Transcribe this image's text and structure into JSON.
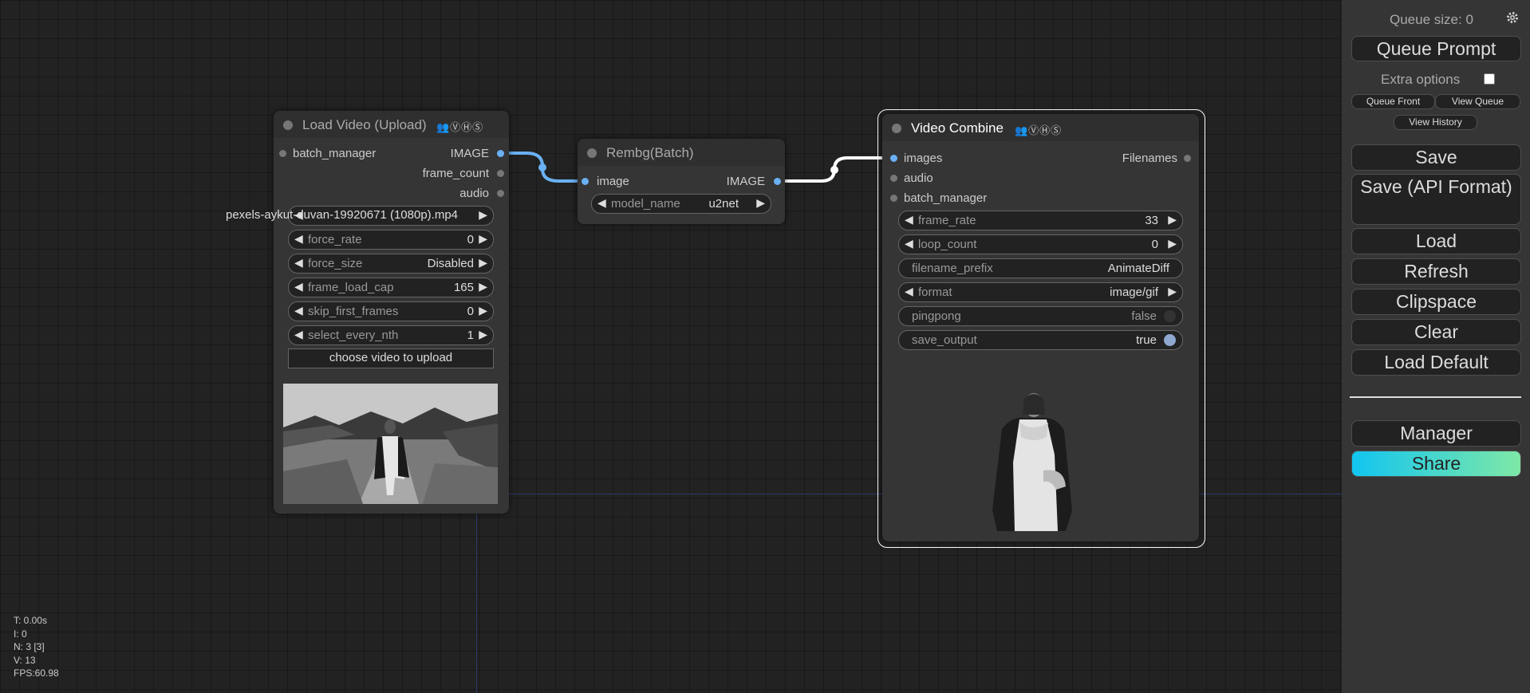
{
  "load_video": {
    "title": "Load Video (Upload)",
    "badges": "👥ⓋⒽⓈ",
    "inputs": [
      "batch_manager"
    ],
    "outputs": [
      "IMAGE",
      "frame_count",
      "audio"
    ],
    "video_name": "pexels-aykut-duvan-19920671 (1080p).mp4",
    "widgets": [
      {
        "label": "force_rate",
        "value": "0"
      },
      {
        "label": "force_size",
        "value": "Disabled"
      },
      {
        "label": "frame_load_cap",
        "value": "165"
      },
      {
        "label": "skip_first_frames",
        "value": "0"
      },
      {
        "label": "select_every_nth",
        "value": "1"
      }
    ],
    "upload_button": "choose video to upload"
  },
  "rembg": {
    "title": "Rembg(Batch)",
    "input": "image",
    "output": "IMAGE",
    "widget": {
      "label": "model_name",
      "value": "u2net"
    }
  },
  "video_combine": {
    "title": "Video Combine",
    "badges": "👥ⓋⒽⓈ",
    "inputs": [
      "images",
      "audio",
      "batch_manager"
    ],
    "output": "Filenames",
    "widgets": [
      {
        "label": "frame_rate",
        "value": "33"
      },
      {
        "label": "loop_count",
        "value": "0"
      },
      {
        "label": "filename_prefix",
        "value": "AnimateDiff"
      },
      {
        "label": "format",
        "value": "image/gif"
      },
      {
        "label": "pingpong",
        "value": "false"
      },
      {
        "label": "save_output",
        "value": "true"
      }
    ]
  },
  "menu": {
    "queue_size": "Queue size: 0",
    "queue_prompt": "Queue Prompt",
    "extra_options": "Extra options",
    "queue_front": "Queue Front",
    "view_queue": "View Queue",
    "view_history": "View History",
    "save": "Save",
    "save_api": "Save (API Format)",
    "load": "Load",
    "refresh": "Refresh",
    "clipspace": "Clipspace",
    "clear": "Clear",
    "load_default": "Load Default",
    "manager": "Manager",
    "share": "Share"
  },
  "stats": {
    "t": "T: 0.00s",
    "i": "I: 0",
    "n": "N: 3 [3]",
    "v": "V: 13",
    "fps": "FPS:60.98"
  },
  "colors": {
    "accent_link": "#6ab0f3",
    "share_gradient_start": "#12c5f0",
    "share_gradient_end": "#7ee8a6"
  }
}
